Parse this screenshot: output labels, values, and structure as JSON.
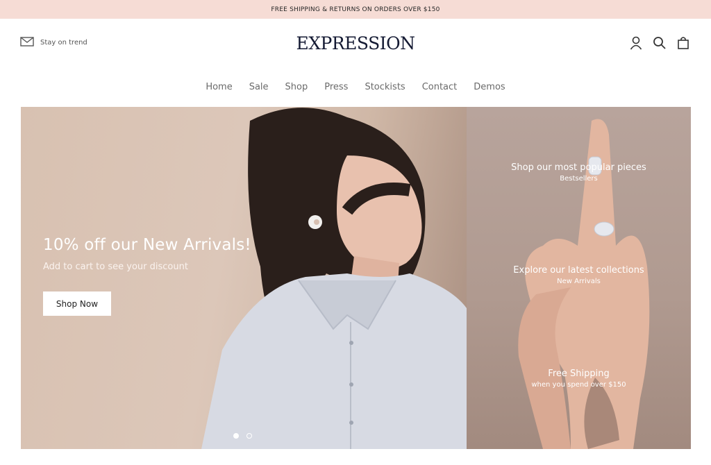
{
  "announcement": "FREE SHIPPING & RETURNS ON ORDERS OVER $150",
  "header": {
    "newsletter_label": "Stay on trend",
    "logo": "EXPRESSION",
    "icons": [
      "account-icon",
      "search-icon",
      "cart-icon"
    ]
  },
  "nav": [
    "Home",
    "Sale",
    "Shop",
    "Press",
    "Stockists",
    "Contact",
    "Demos"
  ],
  "hero": {
    "title": "10% off our New Arrivals!",
    "subtitle": "Add to cart to see your discount",
    "button": "Shop Now",
    "slides": 2,
    "active_slide": 1
  },
  "promos": [
    {
      "title": "Shop our most popular pieces",
      "subtitle": "Bestsellers"
    },
    {
      "title": "Explore our latest collections",
      "subtitle": "New Arrivals"
    },
    {
      "title": "Free Shipping",
      "subtitle": "when you spend over $150"
    }
  ],
  "colors": {
    "announcement_bg": "#f6dcd5",
    "logo": "#141a33",
    "nav_text": "#6a6a6a"
  }
}
